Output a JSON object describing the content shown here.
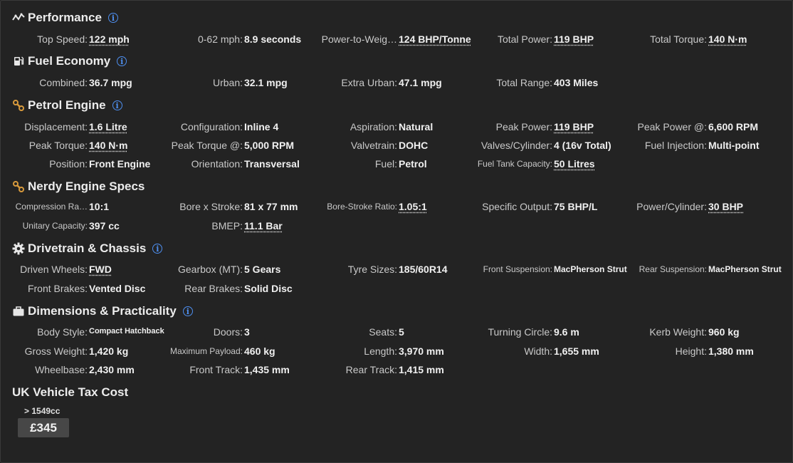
{
  "sections": {
    "performance": {
      "title": "Performance",
      "icon": "chart-line-icon",
      "rows": [
        [
          {
            "label": "Top Speed:",
            "value": "122 mph"
          },
          {
            "label": "0-62 mph:",
            "value": "8.9 seconds"
          },
          {
            "label": "Power-to-Weig…",
            "value": "124 BHP/Tonne"
          },
          {
            "label": "Total Power:",
            "value": "119 BHP"
          },
          {
            "label": "Total Torque:",
            "value": "140 N·m"
          }
        ]
      ]
    },
    "fuel": {
      "title": "Fuel Economy",
      "icon": "fuel-pump-icon",
      "rows": [
        [
          {
            "label": "Combined:",
            "value": "36.7 mpg"
          },
          {
            "label": "Urban:",
            "value": "32.1 mpg"
          },
          {
            "label": "Extra Urban:",
            "value": "47.1 mpg"
          },
          {
            "label": "Total Range:",
            "value": "403 Miles"
          }
        ]
      ]
    },
    "engine": {
      "title": "Petrol Engine",
      "icon": "engine-icon",
      "rows": [
        [
          {
            "label": "Displacement:",
            "value": "1.6 Litre"
          },
          {
            "label": "Configuration:",
            "value": "Inline 4"
          },
          {
            "label": "Aspiration:",
            "value": "Natural"
          },
          {
            "label": "Peak Power:",
            "value": "119 BHP"
          },
          {
            "label": "Peak Power @:",
            "value": "6,600 RPM"
          }
        ],
        [
          {
            "label": "Peak Torque:",
            "value": "140 N·m"
          },
          {
            "label": "Peak Torque @:",
            "value": "5,000 RPM"
          },
          {
            "label": "Valvetrain:",
            "value": "DOHC"
          },
          {
            "label": "Valves/Cylinder:",
            "value": "4 (16v Total)"
          },
          {
            "label": "Fuel Injection:",
            "value": "Multi-point"
          }
        ],
        [
          {
            "label": "Position:",
            "value": "Front Engine"
          },
          {
            "label": "Orientation:",
            "value": "Transversal"
          },
          {
            "label": "Fuel:",
            "value": "Petrol"
          },
          {
            "label": "Fuel Tank Capacity:",
            "value": "50 Litres"
          }
        ]
      ]
    },
    "nerdy": {
      "title": "Nerdy Engine Specs",
      "icon": "engine-icon",
      "rows": [
        [
          {
            "label": "Compression Ra…",
            "value": "10:1"
          },
          {
            "label": "Bore x Stroke:",
            "value": "81 x 77 mm"
          },
          {
            "label": "Bore-Stroke Ratio:",
            "value": "1.05:1"
          },
          {
            "label": "Specific Output:",
            "value": "75 BHP/L"
          },
          {
            "label": "Power/Cylinder:",
            "value": "30 BHP"
          }
        ],
        [
          {
            "label": "Unitary Capacity:",
            "value": "397 cc"
          },
          {
            "label": "BMEP:",
            "value": "11.1 Bar"
          }
        ]
      ]
    },
    "drivetrain": {
      "title": "Drivetrain & Chassis",
      "icon": "gear-icon",
      "rows": [
        [
          {
            "label": "Driven Wheels:",
            "value": "FWD"
          },
          {
            "label": "Gearbox (MT):",
            "value": "5 Gears"
          },
          {
            "label": "Tyre Sizes:",
            "value": "185/60R14"
          },
          {
            "label": "Front Suspension:",
            "value": "MacPherson Strut"
          },
          {
            "label": "Rear Suspension:",
            "value": "MacPherson Strut"
          }
        ],
        [
          {
            "label": "Front Brakes:",
            "value": "Vented Disc"
          },
          {
            "label": "Rear Brakes:",
            "value": "Solid Disc"
          }
        ]
      ]
    },
    "dimensions": {
      "title": "Dimensions & Practicality",
      "icon": "briefcase-icon",
      "rows": [
        [
          {
            "label": "Body Style:",
            "value": "Compact Hatchback"
          },
          {
            "label": "Doors:",
            "value": "3"
          },
          {
            "label": "Seats:",
            "value": "5"
          },
          {
            "label": "Turning Circle:",
            "value": "9.6 m"
          },
          {
            "label": "Kerb Weight:",
            "value": "960 kg"
          }
        ],
        [
          {
            "label": "Gross Weight:",
            "value": "1,420 kg"
          },
          {
            "label": "Maximum Payload:",
            "value": "460 kg"
          },
          {
            "label": "Length:",
            "value": "3,970 mm"
          },
          {
            "label": "Width:",
            "value": "1,655 mm"
          },
          {
            "label": "Height:",
            "value": "1,380 mm"
          }
        ],
        [
          {
            "label": "Wheelbase:",
            "value": "2,430 mm"
          },
          {
            "label": "Front Track:",
            "value": "1,435 mm"
          },
          {
            "label": "Rear Track:",
            "value": "1,415 mm"
          }
        ]
      ]
    }
  },
  "tax": {
    "title": "UK Vehicle Tax Cost",
    "band": "> 1549cc",
    "price": "£345"
  },
  "colors": {
    "background": "#232323",
    "info_icon": "#4e8ff0",
    "engine_icon": "#d89a3c",
    "price_box": "#474747"
  }
}
